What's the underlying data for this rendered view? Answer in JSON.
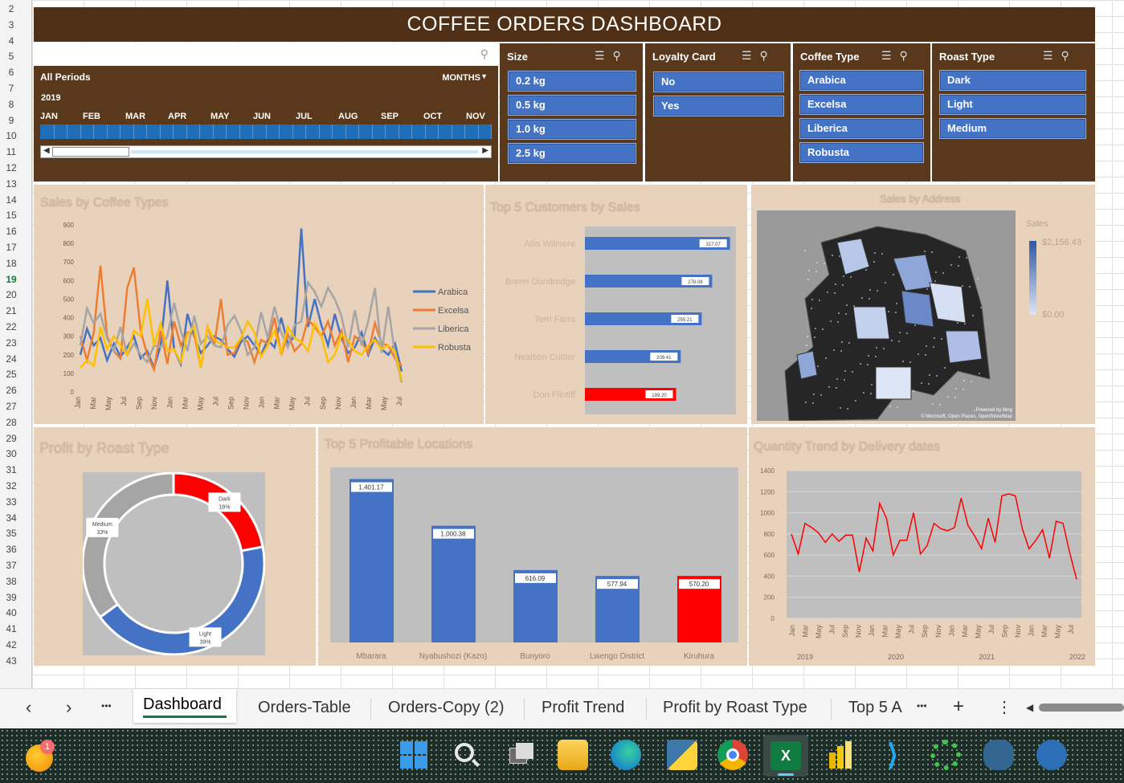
{
  "dashboard_title": "COFFEE ORDERS DASHBOARD",
  "timeline": {
    "period_label": "All Periods",
    "unit_label": "MONTHS",
    "year": "2019",
    "months": [
      "JAN",
      "FEB",
      "MAR",
      "APR",
      "MAY",
      "JUN",
      "JUL",
      "AUG",
      "SEP",
      "OCT",
      "NOV"
    ]
  },
  "slicers": {
    "size": {
      "title": "Size",
      "items": [
        "0.2 kg",
        "0.5 kg",
        "1.0 kg",
        "2.5 kg"
      ]
    },
    "loyalty": {
      "title": "Loyalty Card",
      "items": [
        "No",
        "Yes"
      ]
    },
    "coffee_type": {
      "title": "Coffee Type",
      "items": [
        "Arabica",
        "Excelsa",
        "Liberica",
        "Robusta"
      ]
    },
    "roast_type": {
      "title": "Roast Type",
      "items": [
        "Dark",
        "Light",
        "Medium"
      ]
    }
  },
  "row_numbers": [
    "2",
    "3",
    "4",
    "5",
    "6",
    "7",
    "8",
    "9",
    "10",
    "11",
    "12",
    "13",
    "14",
    "15",
    "16",
    "17",
    "18",
    "19",
    "20",
    "21",
    "22",
    "23",
    "24",
    "25",
    "26",
    "27",
    "28",
    "29",
    "30",
    "31",
    "32",
    "33",
    "34",
    "35",
    "36",
    "37",
    "38",
    "39",
    "40",
    "41",
    "42",
    "43"
  ],
  "chart_data": [
    {
      "type": "line",
      "title": "Sales by Coffee Types",
      "ylim": [
        0,
        900
      ],
      "yticks": [
        "0",
        "100",
        "200",
        "300",
        "400",
        "500",
        "600",
        "700",
        "800",
        "900"
      ],
      "xticks": [
        "Jan",
        "Mar",
        "May",
        "Jul",
        "Sep",
        "Nov",
        "Jan",
        "Mar",
        "May",
        "Jul",
        "Sep",
        "Nov",
        "Jan",
        "Mar",
        "May",
        "Jul",
        "Sep",
        "Nov",
        "Jan",
        "Mar",
        "May",
        "Jul"
      ],
      "series": [
        {
          "name": "Arabica",
          "color": "#4472c4",
          "values": [
            200,
            340,
            250,
            290,
            170,
            260,
            190,
            240,
            300,
            180,
            220,
            130,
            250,
            600,
            230,
            150,
            420,
            300,
            210,
            250,
            300,
            280,
            230,
            190,
            270,
            300,
            250,
            200,
            280,
            240,
            400,
            260,
            300,
            880,
            350,
            500,
            360,
            250,
            420,
            290,
            210,
            240,
            320,
            200,
            290,
            230,
            200,
            260,
            110
          ]
        },
        {
          "name": "Excelsa",
          "color": "#ed7d31",
          "values": [
            300,
            170,
            320,
            680,
            300,
            220,
            180,
            560,
            670,
            330,
            200,
            120,
            330,
            150,
            380,
            250,
            320,
            310,
            130,
            350,
            250,
            500,
            200,
            210,
            290,
            270,
            160,
            280,
            260,
            400,
            200,
            310,
            220,
            260,
            390,
            350,
            300,
            380,
            250,
            330,
            160,
            300,
            270,
            210,
            370,
            260,
            250,
            180,
            140
          ]
        },
        {
          "name": "Liberica",
          "color": "#a5a5a5",
          "values": [
            250,
            450,
            370,
            420,
            290,
            220,
            350,
            200,
            260,
            200,
            160,
            250,
            240,
            300,
            480,
            330,
            220,
            410,
            260,
            300,
            250,
            240,
            360,
            410,
            330,
            200,
            240,
            430,
            290,
            460,
            320,
            240,
            360,
            380,
            590,
            540,
            460,
            560,
            500,
            410,
            240,
            440,
            250,
            380,
            560,
            210,
            460,
            200,
            50
          ]
        },
        {
          "name": "Robusta",
          "color": "#ffc000",
          "values": [
            130,
            170,
            140,
            350,
            230,
            300,
            250,
            200,
            330,
            300,
            500,
            250,
            370,
            220,
            230,
            160,
            310,
            350,
            130,
            350,
            280,
            260,
            240,
            240,
            290,
            380,
            320,
            190,
            250,
            330,
            210,
            350,
            290,
            270,
            220,
            370,
            300,
            160,
            200,
            310,
            280,
            220,
            200,
            250,
            280,
            230,
            250,
            220,
            60
          ]
        }
      ],
      "legend_position": "right"
    },
    {
      "type": "bar",
      "orientation": "horizontal",
      "title": "Top 5 Customers by Sales",
      "categories": [
        "Allis Wilmore",
        "Brenn Dundredge",
        "Terri Farra",
        "Nealson Cuttler",
        "Don Flintiff"
      ],
      "values": [
        317.07,
        278.08,
        255.21,
        209.41,
        199.2
      ],
      "labels": [
        "317.07",
        "278.08",
        "255.21",
        "209.41",
        "199.20"
      ],
      "colors": [
        "#4472c4",
        "#4472c4",
        "#4472c4",
        "#4472c4",
        "#ff0000"
      ]
    },
    {
      "type": "heatmap",
      "title": "Sales by Address",
      "legend_title": "Sales",
      "legend_max": "$2,156.43",
      "legend_min": "$0.00",
      "credit1": "Powered by Bing",
      "credit2": "© Microsoft, Open Places, OpenStreetMap"
    },
    {
      "type": "pie",
      "title": "Profit by Roast Type",
      "categories": [
        "Dark",
        "Light",
        "Medium"
      ],
      "values": [
        22,
        43,
        35
      ],
      "labels": [
        "Dark 18%",
        "Light 39%",
        "Medium 33%"
      ],
      "colors": [
        "#ff0000",
        "#4472c4",
        "#a5a5a5"
      ]
    },
    {
      "type": "bar",
      "title": "Top 5 Profitable Locations",
      "categories": [
        "Mbarara",
        "Nyabushozi (Kazo)",
        "Bunyoro",
        "Lwengo District",
        "Kiruhura"
      ],
      "values": [
        1400,
        1000,
        620,
        570,
        570
      ],
      "labels": [
        "1,401.17",
        "1,000.38",
        "616.09",
        "577.94",
        "570.20"
      ],
      "ylim": [
        0,
        1500
      ],
      "colors": [
        "#4472c4",
        "#4472c4",
        "#4472c4",
        "#4472c4",
        "#ff0000"
      ]
    },
    {
      "type": "line",
      "title": "Quantity Trend by Delivery dates",
      "ylim": [
        0,
        1400
      ],
      "yticks": [
        "0",
        "200",
        "400",
        "600",
        "800",
        "1000",
        "1200",
        "1400"
      ],
      "xticks": [
        "Jan",
        "Mar",
        "May",
        "Jul",
        "Sep",
        "Nov",
        "Jan",
        "Mar",
        "May",
        "Jul",
        "Sep",
        "Nov",
        "Jan",
        "Mar",
        "May",
        "Jul",
        "Sep",
        "Nov",
        "Jan",
        "Mar",
        "May",
        "Jul"
      ],
      "year_labels": [
        "2019",
        "2020",
        "2021",
        "2022"
      ],
      "series": [
        {
          "name": "Quantity",
          "color": "#ff0000",
          "values": [
            800,
            610,
            900,
            860,
            810,
            720,
            800,
            730,
            790,
            790,
            440,
            760,
            640,
            1090,
            950,
            600,
            740,
            740,
            1000,
            610,
            690,
            900,
            850,
            830,
            860,
            1140,
            880,
            780,
            660,
            950,
            720,
            1160,
            1180,
            1160,
            850,
            660,
            740,
            840,
            570,
            920,
            900,
            620,
            370
          ]
        }
      ]
    }
  ],
  "sheet_tabs": [
    "Dashboard",
    "Orders-Table",
    "Orders-Copy (2)",
    "Profit Trend",
    "Profit by Roast Type",
    "Top 5 A"
  ],
  "tab_controls": {
    "prev": "‹",
    "next": "›",
    "more": "•••",
    "add": "+",
    "menu": "⋮"
  },
  "taskbar": {
    "badge": "1"
  }
}
